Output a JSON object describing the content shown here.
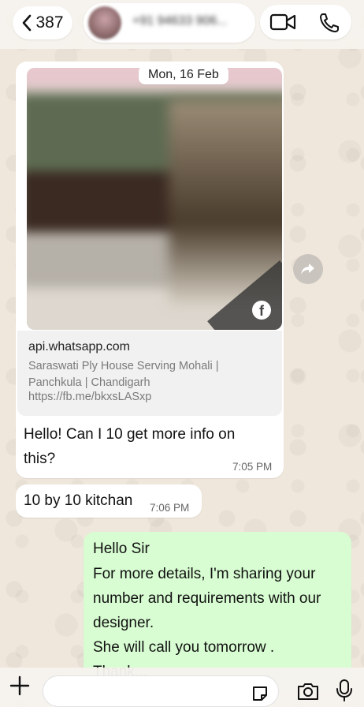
{
  "header": {
    "back_count": "387",
    "contact_name": "+91 94633 906..."
  },
  "chat": {
    "date_chip": "Mon, 16 Feb",
    "link_preview": {
      "domain": "api.whatsapp.com",
      "description": "Saraswati Ply House Serving Mohali | Panchkula | Chandigarh",
      "url": "https://fb.me/bkxsLASxp"
    },
    "incoming": [
      {
        "text": "Hello! Can I 10 get more info on this?",
        "line1": "Hello! Can I 10 get more info on",
        "line2": "this?",
        "time": "7:05 PM"
      },
      {
        "text": "10 by 10 kitchan",
        "time": "7:06 PM"
      }
    ],
    "outgoing": {
      "lines": [
        "Hello Sir",
        "For more details, I'm sharing your",
        "number and requirements with our",
        "designer.",
        "She will call you tomorrow .",
        "Thank..."
      ]
    }
  },
  "colors": {
    "wallpaper": "#efe7dc",
    "incoming_bubble": "#ffffff",
    "outgoing_bubble": "#d8fdd2"
  }
}
